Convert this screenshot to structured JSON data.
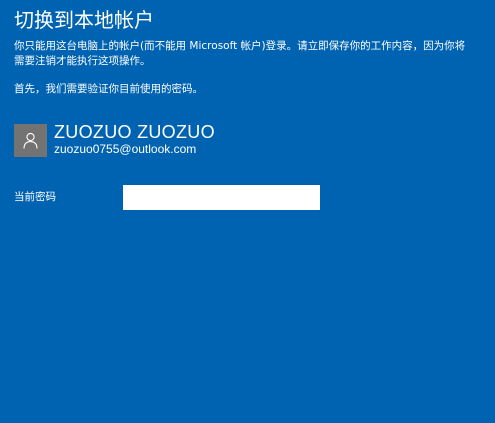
{
  "page": {
    "title": "切换到本地帐户",
    "description": "你只能用这台电脑上的帐户(而不能用 Microsoft 帐户)登录。请立即保存你的工作内容，因为你将需要注销才能执行这项操作。",
    "verify_prompt": "首先，我们需要验证你目前使用的密码。"
  },
  "account": {
    "avatar_icon": "user-silhouette-icon",
    "name": "ZUOZUO ZUOZUO",
    "email": "zuozuo0755@outlook.com"
  },
  "password": {
    "label": "当前密码",
    "value": "",
    "placeholder": ""
  },
  "colors": {
    "background": "#0063b1",
    "avatar_background": "#737373",
    "text": "#ffffff",
    "input_background": "#ffffff"
  }
}
